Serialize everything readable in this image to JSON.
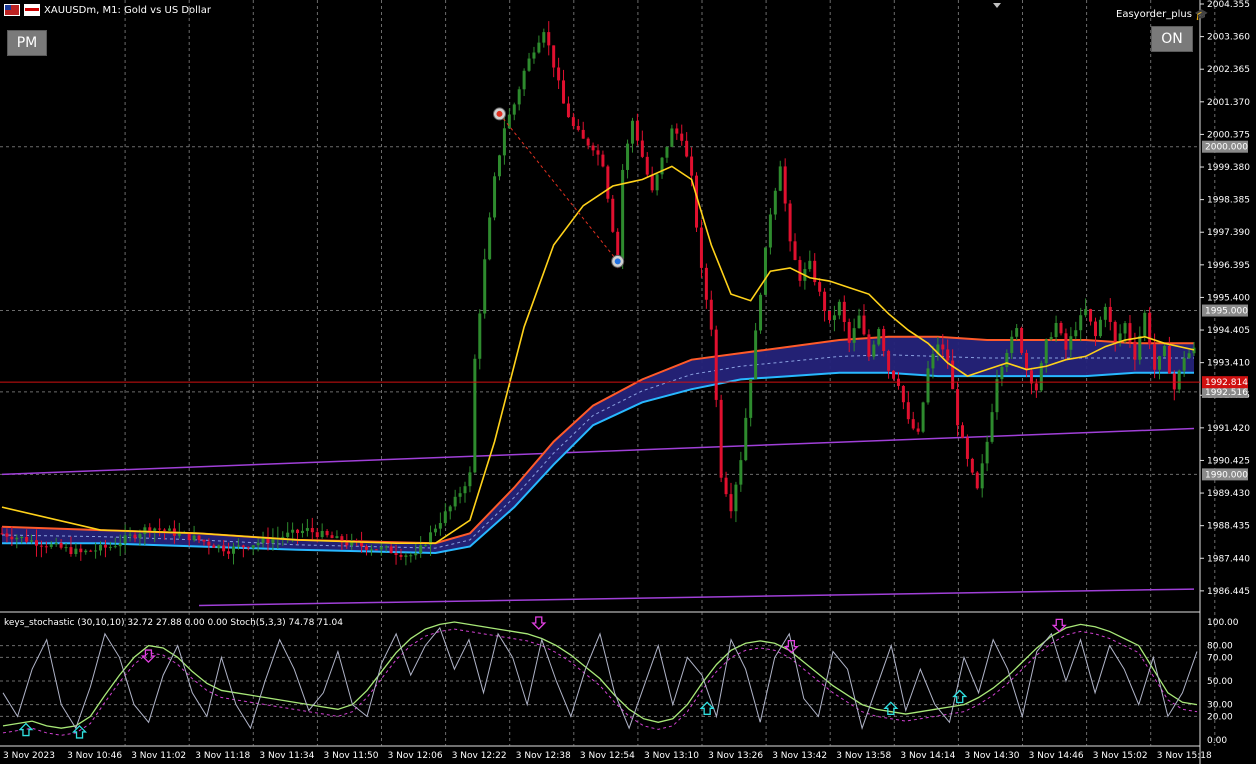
{
  "header": {
    "symbol_title": "XAUUSDm, M1:  Gold vs US Dollar",
    "ea_name": "Easyorder_plus",
    "pm_button": "PM",
    "on_button": "ON",
    "hat_icon": "graduation-cap-icon"
  },
  "indicator_label": "keys_stochastic (30,10,10) 32.72 27.88 0.00 0.00 Stoch(5,3,3) 74.78 71.04",
  "chart_data": [
    {
      "type": "candlestick",
      "title": "XAUUSDm, M1:  Gold vs US Dollar",
      "ylim": [
        1985.8,
        2004.355
      ],
      "y_ticks": [
        "2004.355",
        "2003.360",
        "2002.365",
        "2001.370",
        "2000.375",
        "1999.380",
        "1998.385",
        "1997.390",
        "1996.395",
        "1995.400",
        "1994.405",
        "1993.410",
        "1992.415",
        "1991.420",
        "1990.425",
        "1989.430",
        "1988.435",
        "1987.440",
        "1986.445"
      ],
      "price_tags": [
        {
          "label": "2000.000",
          "value": 2000.0,
          "color": "#8a8a8a"
        },
        {
          "label": "1995.000",
          "value": 1995.0,
          "color": "#8a8a8a"
        },
        {
          "label": "1992.516",
          "value": 1992.516,
          "color": "#8a8a8a"
        },
        {
          "label": "1992.814",
          "value": 1992.814,
          "color": "#d01010"
        },
        {
          "label": "1990.000",
          "value": 1990.0,
          "color": "#8a8a8a"
        }
      ],
      "x_ticks": [
        "3 Nov 2023",
        "3 Nov 10:46",
        "3 Nov 11:02",
        "3 Nov 11:18",
        "3 Nov 11:34",
        "3 Nov 11:50",
        "3 Nov 12:06",
        "3 Nov 12:22",
        "3 Nov 12:38",
        "3 Nov 12:54",
        "3 Nov 13:10",
        "3 Nov 13:26",
        "3 Nov 13:42",
        "3 Nov 13:58",
        "3 Nov 14:14",
        "3 Nov 14:30",
        "3 Nov 14:46",
        "3 Nov 15:02",
        "3 Nov 15:18"
      ],
      "close_path": [
        [
          0,
          1988.2
        ],
        [
          8,
          1987.9
        ],
        [
          16,
          1987.6
        ],
        [
          22,
          1987.8
        ],
        [
          30,
          1988.4
        ],
        [
          38,
          1988.1
        ],
        [
          46,
          1987.7
        ],
        [
          54,
          1988.0
        ],
        [
          62,
          1988.3
        ],
        [
          70,
          1987.9
        ],
        [
          78,
          1987.7
        ],
        [
          84,
          1987.5
        ],
        [
          88,
          1988.4
        ],
        [
          92,
          1989.2
        ],
        [
          95,
          1990.0
        ],
        [
          96,
          1993.5
        ],
        [
          98,
          1996.5
        ],
        [
          100,
          1999.0
        ],
        [
          102,
          2000.6
        ],
        [
          104,
          2001.3
        ],
        [
          106,
          2002.3
        ],
        [
          108,
          2003.0
        ],
        [
          110,
          2003.6
        ],
        [
          112,
          2002.5
        ],
        [
          114,
          2001.3
        ],
        [
          116,
          2000.6
        ],
        [
          118,
          2000.2
        ],
        [
          120,
          2000.0
        ],
        [
          122,
          1999.5
        ],
        [
          124,
          1997.5
        ],
        [
          125,
          1996.6
        ],
        [
          126,
          1999.3
        ],
        [
          128,
          2000.8
        ],
        [
          130,
          1999.7
        ],
        [
          132,
          1998.6
        ],
        [
          134,
          1999.6
        ],
        [
          136,
          2000.5
        ],
        [
          138,
          2000.3
        ],
        [
          140,
          1999.0
        ],
        [
          142,
          1996.2
        ],
        [
          144,
          1994.5
        ],
        [
          146,
          1990.0
        ],
        [
          148,
          1989.0
        ],
        [
          150,
          1990.5
        ],
        [
          152,
          1993.0
        ],
        [
          154,
          1995.6
        ],
        [
          156,
          1998.0
        ],
        [
          158,
          1999.5
        ],
        [
          160,
          1997.0
        ],
        [
          162,
          1996.0
        ],
        [
          164,
          1996.4
        ],
        [
          166,
          1995.5
        ],
        [
          168,
          1994.6
        ],
        [
          170,
          1995.2
        ],
        [
          172,
          1994.0
        ],
        [
          174,
          1994.8
        ],
        [
          176,
          1993.6
        ],
        [
          178,
          1994.5
        ],
        [
          180,
          1993.2
        ],
        [
          182,
          1992.8
        ],
        [
          184,
          1991.6
        ],
        [
          186,
          1991.2
        ],
        [
          188,
          1993.2
        ],
        [
          190,
          1994.0
        ],
        [
          192,
          1993.5
        ],
        [
          194,
          1991.6
        ],
        [
          196,
          1990.4
        ],
        [
          198,
          1989.5
        ],
        [
          200,
          1991.0
        ],
        [
          202,
          1993.0
        ],
        [
          204,
          1993.8
        ],
        [
          206,
          1994.4
        ],
        [
          208,
          1993.2
        ],
        [
          210,
          1992.6
        ],
        [
          212,
          1994.0
        ],
        [
          214,
          1994.6
        ],
        [
          216,
          1993.8
        ],
        [
          218,
          1994.5
        ],
        [
          220,
          1995.0
        ],
        [
          222,
          1994.2
        ],
        [
          224,
          1995.2
        ],
        [
          226,
          1994.0
        ],
        [
          228,
          1994.6
        ],
        [
          230,
          1993.6
        ],
        [
          232,
          1994.9
        ],
        [
          234,
          1993.2
        ],
        [
          236,
          1993.8
        ],
        [
          238,
          1992.6
        ],
        [
          240,
          1993.6
        ],
        [
          242,
          1993.8
        ]
      ],
      "sma_yellow": [
        [
          0,
          1989.0
        ],
        [
          20,
          1988.3
        ],
        [
          40,
          1988.2
        ],
        [
          60,
          1988.0
        ],
        [
          80,
          1987.9
        ],
        [
          88,
          1987.9
        ],
        [
          95,
          1988.6
        ],
        [
          100,
          1991.0
        ],
        [
          106,
          1994.5
        ],
        [
          112,
          1997.0
        ],
        [
          118,
          1998.2
        ],
        [
          124,
          1998.8
        ],
        [
          130,
          1999.0
        ],
        [
          136,
          1999.4
        ],
        [
          140,
          1999.0
        ],
        [
          144,
          1997.0
        ],
        [
          148,
          1995.5
        ],
        [
          152,
          1995.3
        ],
        [
          156,
          1996.2
        ],
        [
          160,
          1996.3
        ],
        [
          164,
          1996.0
        ],
        [
          168,
          1995.9
        ],
        [
          172,
          1995.7
        ],
        [
          176,
          1995.5
        ],
        [
          180,
          1994.9
        ],
        [
          184,
          1994.4
        ],
        [
          188,
          1994.0
        ],
        [
          192,
          1993.4
        ],
        [
          196,
          1993.0
        ],
        [
          200,
          1993.2
        ],
        [
          204,
          1993.4
        ],
        [
          208,
          1993.2
        ],
        [
          212,
          1993.3
        ],
        [
          216,
          1993.5
        ],
        [
          220,
          1993.6
        ],
        [
          224,
          1993.9
        ],
        [
          228,
          1994.1
        ],
        [
          232,
          1994.2
        ],
        [
          236,
          1994.0
        ],
        [
          242,
          1993.8
        ]
      ],
      "band_upper": [
        [
          0,
          1988.4
        ],
        [
          20,
          1988.3
        ],
        [
          40,
          1988.2
        ],
        [
          60,
          1988.0
        ],
        [
          88,
          1987.9
        ],
        [
          95,
          1988.2
        ],
        [
          104,
          1989.6
        ],
        [
          112,
          1991.0
        ],
        [
          120,
          1992.1
        ],
        [
          130,
          1992.9
        ],
        [
          140,
          1993.5
        ],
        [
          150,
          1993.7
        ],
        [
          160,
          1993.9
        ],
        [
          170,
          1994.1
        ],
        [
          180,
          1994.2
        ],
        [
          190,
          1994.2
        ],
        [
          200,
          1994.1
        ],
        [
          210,
          1994.1
        ],
        [
          220,
          1994.1
        ],
        [
          230,
          1994.0
        ],
        [
          242,
          1994.0
        ]
      ],
      "band_lower": [
        [
          0,
          1987.9
        ],
        [
          20,
          1987.9
        ],
        [
          40,
          1987.8
        ],
        [
          60,
          1987.7
        ],
        [
          88,
          1987.6
        ],
        [
          95,
          1987.8
        ],
        [
          104,
          1989.0
        ],
        [
          112,
          1990.3
        ],
        [
          120,
          1991.5
        ],
        [
          130,
          1992.2
        ],
        [
          140,
          1992.6
        ],
        [
          150,
          1992.9
        ],
        [
          160,
          1993.0
        ],
        [
          170,
          1993.1
        ],
        [
          180,
          1993.1
        ],
        [
          190,
          1993.0
        ],
        [
          200,
          1993.0
        ],
        [
          210,
          1993.0
        ],
        [
          220,
          1993.0
        ],
        [
          230,
          1993.1
        ],
        [
          242,
          1993.1
        ]
      ],
      "trend_upper": [
        [
          0,
          1990.0
        ],
        [
          242,
          1991.4
        ]
      ],
      "trend_lower": [
        [
          40,
          1986.0
        ],
        [
          242,
          1986.5
        ]
      ],
      "trade_markers": [
        {
          "x": 101,
          "y": 2001.0,
          "kind": "sell"
        },
        {
          "x": 125,
          "y": 1996.5,
          "kind": "buy"
        }
      ],
      "colors": {
        "up": "#2e8b2e",
        "down": "#e0102f",
        "sma": "#ffd21a",
        "band_fill": "#25237a",
        "band_top": "#ff5a2a",
        "band_bottom": "#28b8ff",
        "trend": "#a040d8"
      }
    },
    {
      "type": "line",
      "title": "keys_stochastic (30,10,10) 32.72 27.88 0.00 0.00 Stoch(5,3,3) 74.78 71.04",
      "ylim": [
        0,
        100
      ],
      "y_ticks": [
        "100.00",
        "80.00",
        "70.00",
        "50.00",
        "30.00",
        "20.00",
        "0.00"
      ],
      "series": [
        {
          "name": "keys_stochastic",
          "color": "#a8e878",
          "values": [
            12,
            14,
            16,
            12,
            10,
            12,
            20,
            38,
            55,
            70,
            80,
            78,
            70,
            58,
            48,
            42,
            40,
            38,
            36,
            34,
            32,
            30,
            28,
            26,
            30,
            42,
            58,
            74,
            86,
            94,
            98,
            100,
            98,
            96,
            94,
            92,
            90,
            86,
            80,
            72,
            62,
            52,
            38,
            26,
            18,
            15,
            18,
            30,
            48,
            64,
            76,
            82,
            84,
            82,
            76,
            66,
            56,
            46,
            38,
            30,
            26,
            24,
            22,
            24,
            26,
            28,
            30,
            36,
            44,
            54,
            66,
            78,
            88,
            95,
            98,
            96,
            92,
            86,
            80,
            60,
            40,
            32,
            30
          ]
        },
        {
          "name": "Stoch(5,3,3)",
          "color": "#b0b4c8",
          "values": [
            40,
            20,
            60,
            85,
            30,
            10,
            45,
            90,
            70,
            30,
            15,
            55,
            80,
            40,
            20,
            70,
            30,
            10,
            50,
            85,
            60,
            25,
            40,
            75,
            30,
            20,
            65,
            90,
            55,
            80,
            95,
            60,
            85,
            40,
            90,
            70,
            30,
            85,
            50,
            20,
            60,
            90,
            40,
            10,
            45,
            80,
            30,
            70,
            55,
            20,
            85,
            60,
            15,
            70,
            90,
            35,
            20,
            75,
            60,
            10,
            45,
            80,
            25,
            60,
            30,
            15,
            70,
            40,
            85,
            60,
            20,
            75,
            90,
            50,
            85,
            40,
            80,
            60,
            30,
            70,
            20,
            40,
            75
          ]
        }
      ],
      "markers": [
        {
          "i": 3,
          "v": 8,
          "kind": "up"
        },
        {
          "i": 10,
          "v": 6,
          "kind": "up"
        },
        {
          "i": 19,
          "v": 72,
          "kind": "down"
        },
        {
          "i": 70,
          "v": 100,
          "kind": "down"
        },
        {
          "i": 92,
          "v": 26,
          "kind": "up"
        },
        {
          "i": 103,
          "v": 80,
          "kind": "down"
        },
        {
          "i": 116,
          "v": 26,
          "kind": "up"
        },
        {
          "i": 125,
          "v": 36,
          "kind": "up"
        },
        {
          "i": 138,
          "v": 98,
          "kind": "down"
        }
      ]
    }
  ]
}
